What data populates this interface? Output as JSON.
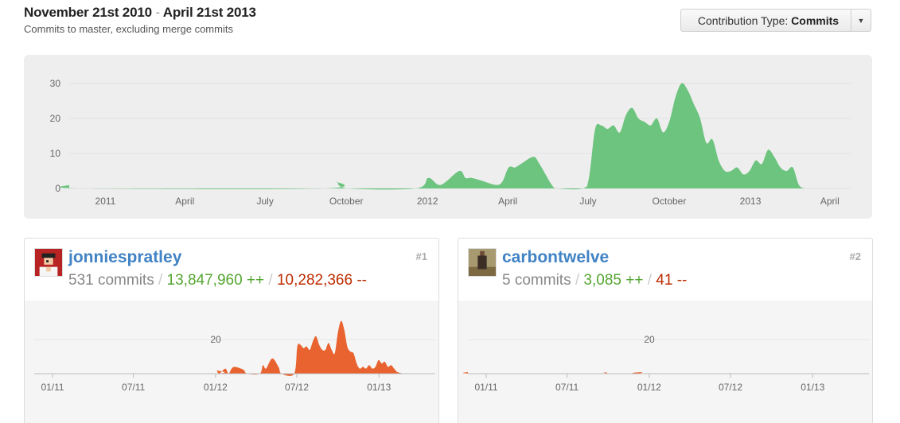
{
  "header": {
    "range_start": "November 21st 2010",
    "range_sep": "-",
    "range_end": "April 21st 2013",
    "subtitle": "Commits to master, excluding merge commits"
  },
  "contribution_type": {
    "label": "Contribution Type:",
    "value": "Commits"
  },
  "colors": {
    "main_area": "#6cc47e",
    "user_area": "#e8632f",
    "link": "#4183c4",
    "additions": "#55a532",
    "deletions": "#bd2c00"
  },
  "chart_data": [
    {
      "type": "area",
      "ylim": [
        0,
        32
      ],
      "y_ticks": [
        "0",
        "10",
        "20",
        "30"
      ],
      "x_ticks": [
        "2011",
        "April",
        "July",
        "October",
        "2012",
        "April",
        "July",
        "October",
        "2013",
        "April"
      ],
      "series": [
        {
          "values": [
            [
              "2010-11-21",
              1
            ],
            [
              "2010-12-05",
              0
            ],
            [
              "2011-09-05",
              0
            ],
            [
              "2011-09-19",
              2
            ],
            [
              "2011-10-03",
              0
            ],
            [
              "2011-12-19",
              0
            ],
            [
              "2012-01-02",
              3
            ],
            [
              "2012-01-16",
              1
            ],
            [
              "2012-02-06",
              5
            ],
            [
              "2012-02-13",
              3
            ],
            [
              "2012-02-20",
              3
            ],
            [
              "2012-03-05",
              2
            ],
            [
              "2012-03-19",
              1
            ],
            [
              "2012-03-26",
              2
            ],
            [
              "2012-04-02",
              6
            ],
            [
              "2012-04-09",
              6
            ],
            [
              "2012-04-16",
              7
            ],
            [
              "2012-04-30",
              9
            ],
            [
              "2012-05-07",
              7
            ],
            [
              "2012-05-21",
              1
            ],
            [
              "2012-05-28",
              0
            ],
            [
              "2012-06-25",
              0
            ],
            [
              "2012-07-02",
              3
            ],
            [
              "2012-07-09",
              17
            ],
            [
              "2012-07-16",
              18
            ],
            [
              "2012-07-23",
              17
            ],
            [
              "2012-07-30",
              18
            ],
            [
              "2012-08-06",
              16
            ],
            [
              "2012-08-13",
              21
            ],
            [
              "2012-08-20",
              23
            ],
            [
              "2012-08-27",
              20
            ],
            [
              "2012-09-03",
              19
            ],
            [
              "2012-09-10",
              18
            ],
            [
              "2012-09-17",
              20
            ],
            [
              "2012-09-24",
              16
            ],
            [
              "2012-10-01",
              19
            ],
            [
              "2012-10-08",
              26
            ],
            [
              "2012-10-15",
              30
            ],
            [
              "2012-10-22",
              28
            ],
            [
              "2012-10-29",
              24
            ],
            [
              "2012-11-05",
              20
            ],
            [
              "2012-11-12",
              13
            ],
            [
              "2012-11-19",
              14
            ],
            [
              "2012-11-26",
              8
            ],
            [
              "2012-12-03",
              5
            ],
            [
              "2012-12-10",
              5
            ],
            [
              "2012-12-17",
              6
            ],
            [
              "2012-12-24",
              4
            ],
            [
              "2012-12-31",
              5
            ],
            [
              "2013-01-07",
              8
            ],
            [
              "2013-01-14",
              7
            ],
            [
              "2013-01-21",
              11
            ],
            [
              "2013-01-28",
              9
            ],
            [
              "2013-02-04",
              6
            ],
            [
              "2013-02-11",
              5
            ],
            [
              "2013-02-18",
              6
            ],
            [
              "2013-02-25",
              1
            ],
            [
              "2013-03-04",
              0
            ]
          ]
        }
      ]
    },
    {
      "type": "area",
      "ylim": [
        0,
        35
      ],
      "y_ticks": [
        "20"
      ],
      "x_ticks": [
        "01/11",
        "07/11",
        "01/12",
        "07/12",
        "01/13"
      ],
      "series": [
        {
          "values": [
            [
              "2010-11-21",
              0
            ],
            [
              "2011-12-19",
              0
            ],
            [
              "2012-01-02",
              2
            ],
            [
              "2012-01-09",
              0
            ],
            [
              "2012-01-23",
              3
            ],
            [
              "2012-01-30",
              0
            ],
            [
              "2012-02-06",
              3
            ],
            [
              "2012-02-13",
              4
            ],
            [
              "2012-02-27",
              3
            ],
            [
              "2012-03-05",
              2
            ],
            [
              "2012-03-12",
              0
            ],
            [
              "2012-04-09",
              0
            ],
            [
              "2012-04-16",
              5
            ],
            [
              "2012-04-23",
              3
            ],
            [
              "2012-05-07",
              9
            ],
            [
              "2012-05-21",
              4
            ],
            [
              "2012-05-28",
              0
            ],
            [
              "2012-06-25",
              0
            ],
            [
              "2012-07-02",
              16
            ],
            [
              "2012-07-09",
              17
            ],
            [
              "2012-07-16",
              15
            ],
            [
              "2012-07-23",
              16
            ],
            [
              "2012-07-30",
              14
            ],
            [
              "2012-08-06",
              19
            ],
            [
              "2012-08-13",
              22
            ],
            [
              "2012-08-20",
              17
            ],
            [
              "2012-08-27",
              14
            ],
            [
              "2012-09-03",
              14
            ],
            [
              "2012-09-10",
              18
            ],
            [
              "2012-09-17",
              14
            ],
            [
              "2012-09-24",
              12
            ],
            [
              "2012-10-01",
              24
            ],
            [
              "2012-10-08",
              31
            ],
            [
              "2012-10-15",
              26
            ],
            [
              "2012-10-22",
              16
            ],
            [
              "2012-10-29",
              13
            ],
            [
              "2012-11-05",
              12
            ],
            [
              "2012-11-12",
              6
            ],
            [
              "2012-11-19",
              3
            ],
            [
              "2012-11-26",
              4
            ],
            [
              "2012-12-03",
              3
            ],
            [
              "2012-12-10",
              5
            ],
            [
              "2012-12-17",
              3
            ],
            [
              "2012-12-24",
              4
            ],
            [
              "2012-12-31",
              8
            ],
            [
              "2013-01-07",
              6
            ],
            [
              "2013-01-14",
              7
            ],
            [
              "2013-01-21",
              4
            ],
            [
              "2013-01-28",
              5
            ],
            [
              "2013-02-04",
              3
            ],
            [
              "2013-02-11",
              1
            ],
            [
              "2013-02-25",
              0
            ]
          ]
        }
      ]
    },
    {
      "type": "area",
      "ylim": [
        0,
        35
      ],
      "y_ticks": [
        "20"
      ],
      "x_ticks": [
        "01/11",
        "07/11",
        "01/12",
        "07/12",
        "01/13"
      ],
      "series": [
        {
          "values": [
            [
              "2010-11-21",
              1
            ],
            [
              "2010-12-05",
              0
            ],
            [
              "2011-09-05",
              0
            ],
            [
              "2011-09-19",
              1
            ],
            [
              "2011-10-03",
              0
            ],
            [
              "2011-12-05",
              0
            ],
            [
              "2011-12-19",
              1
            ],
            [
              "2012-01-02",
              0
            ],
            [
              "2013-04-21",
              0
            ]
          ]
        }
      ]
    }
  ],
  "contributors": [
    {
      "username": "jonniespratley",
      "rank": "#1",
      "commits": "531 commits",
      "additions": "13,847,960 ++",
      "deletions": "10,282,366 --"
    },
    {
      "username": "carbontwelve",
      "rank": "#2",
      "commits": "5 commits",
      "additions": "3,085 ++",
      "deletions": "41 --"
    }
  ]
}
